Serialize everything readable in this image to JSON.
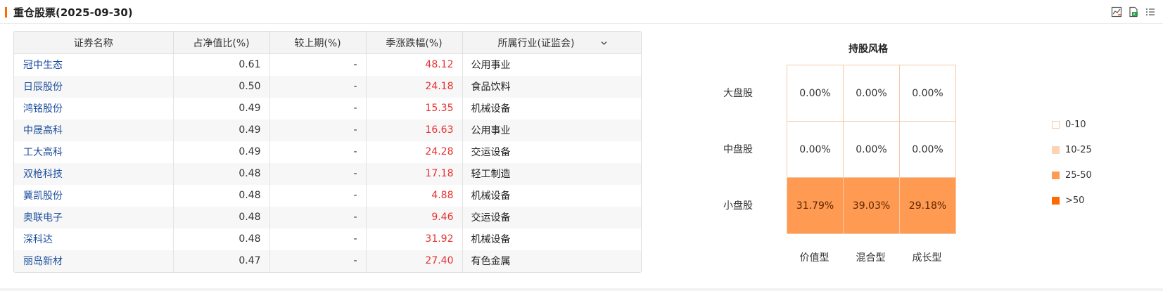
{
  "header": {
    "title": "重仓股票(2025-09-30)",
    "tools": [
      "chart-toggle-icon",
      "excel-export-icon",
      "list-icon"
    ]
  },
  "table": {
    "columns": [
      "证券名称",
      "占净值比(%)",
      "较上期(%)",
      "季涨跌幅(%)",
      "所属行业(证监会)"
    ],
    "rows": [
      {
        "name": "冠中生态",
        "ratio": "0.61",
        "change": "-",
        "quarter": "48.12",
        "industry": "公用事业"
      },
      {
        "name": "日辰股份",
        "ratio": "0.50",
        "change": "-",
        "quarter": "24.18",
        "industry": "食品饮料"
      },
      {
        "name": "鸿铭股份",
        "ratio": "0.49",
        "change": "-",
        "quarter": "15.35",
        "industry": "机械设备"
      },
      {
        "name": "中晟高科",
        "ratio": "0.49",
        "change": "-",
        "quarter": "16.63",
        "industry": "公用事业"
      },
      {
        "name": "工大高科",
        "ratio": "0.49",
        "change": "-",
        "quarter": "24.28",
        "industry": "交运设备"
      },
      {
        "name": "双枪科技",
        "ratio": "0.48",
        "change": "-",
        "quarter": "17.18",
        "industry": "轻工制造"
      },
      {
        "name": "冀凯股份",
        "ratio": "0.48",
        "change": "-",
        "quarter": "4.88",
        "industry": "机械设备"
      },
      {
        "name": "奥联电子",
        "ratio": "0.48",
        "change": "-",
        "quarter": "9.46",
        "industry": "交运设备"
      },
      {
        "name": "深科达",
        "ratio": "0.48",
        "change": "-",
        "quarter": "31.92",
        "industry": "机械设备"
      },
      {
        "name": "丽岛新材",
        "ratio": "0.47",
        "change": "-",
        "quarter": "27.40",
        "industry": "有色金属"
      }
    ]
  },
  "style_box": {
    "title": "持股风格",
    "rows": [
      "大盘股",
      "中盘股",
      "小盘股"
    ],
    "cols": [
      "价值型",
      "混合型",
      "成长型"
    ],
    "values": [
      [
        "0.00%",
        "0.00%",
        "0.00%"
      ],
      [
        "0.00%",
        "0.00%",
        "0.00%"
      ],
      [
        "31.79%",
        "39.03%",
        "29.18%"
      ]
    ],
    "legend": [
      {
        "label": "0-10",
        "color": "#ffffff"
      },
      {
        "label": "10-25",
        "color": "#fcd3b4"
      },
      {
        "label": "25-50",
        "color": "#ff9a52"
      },
      {
        "label": ">50",
        "color": "#ff6a00"
      }
    ]
  },
  "colors": {
    "accent": "#ff6a00",
    "link": "#1d4f9c",
    "up": "#e93030",
    "grid_border": "#f7c9a6"
  }
}
